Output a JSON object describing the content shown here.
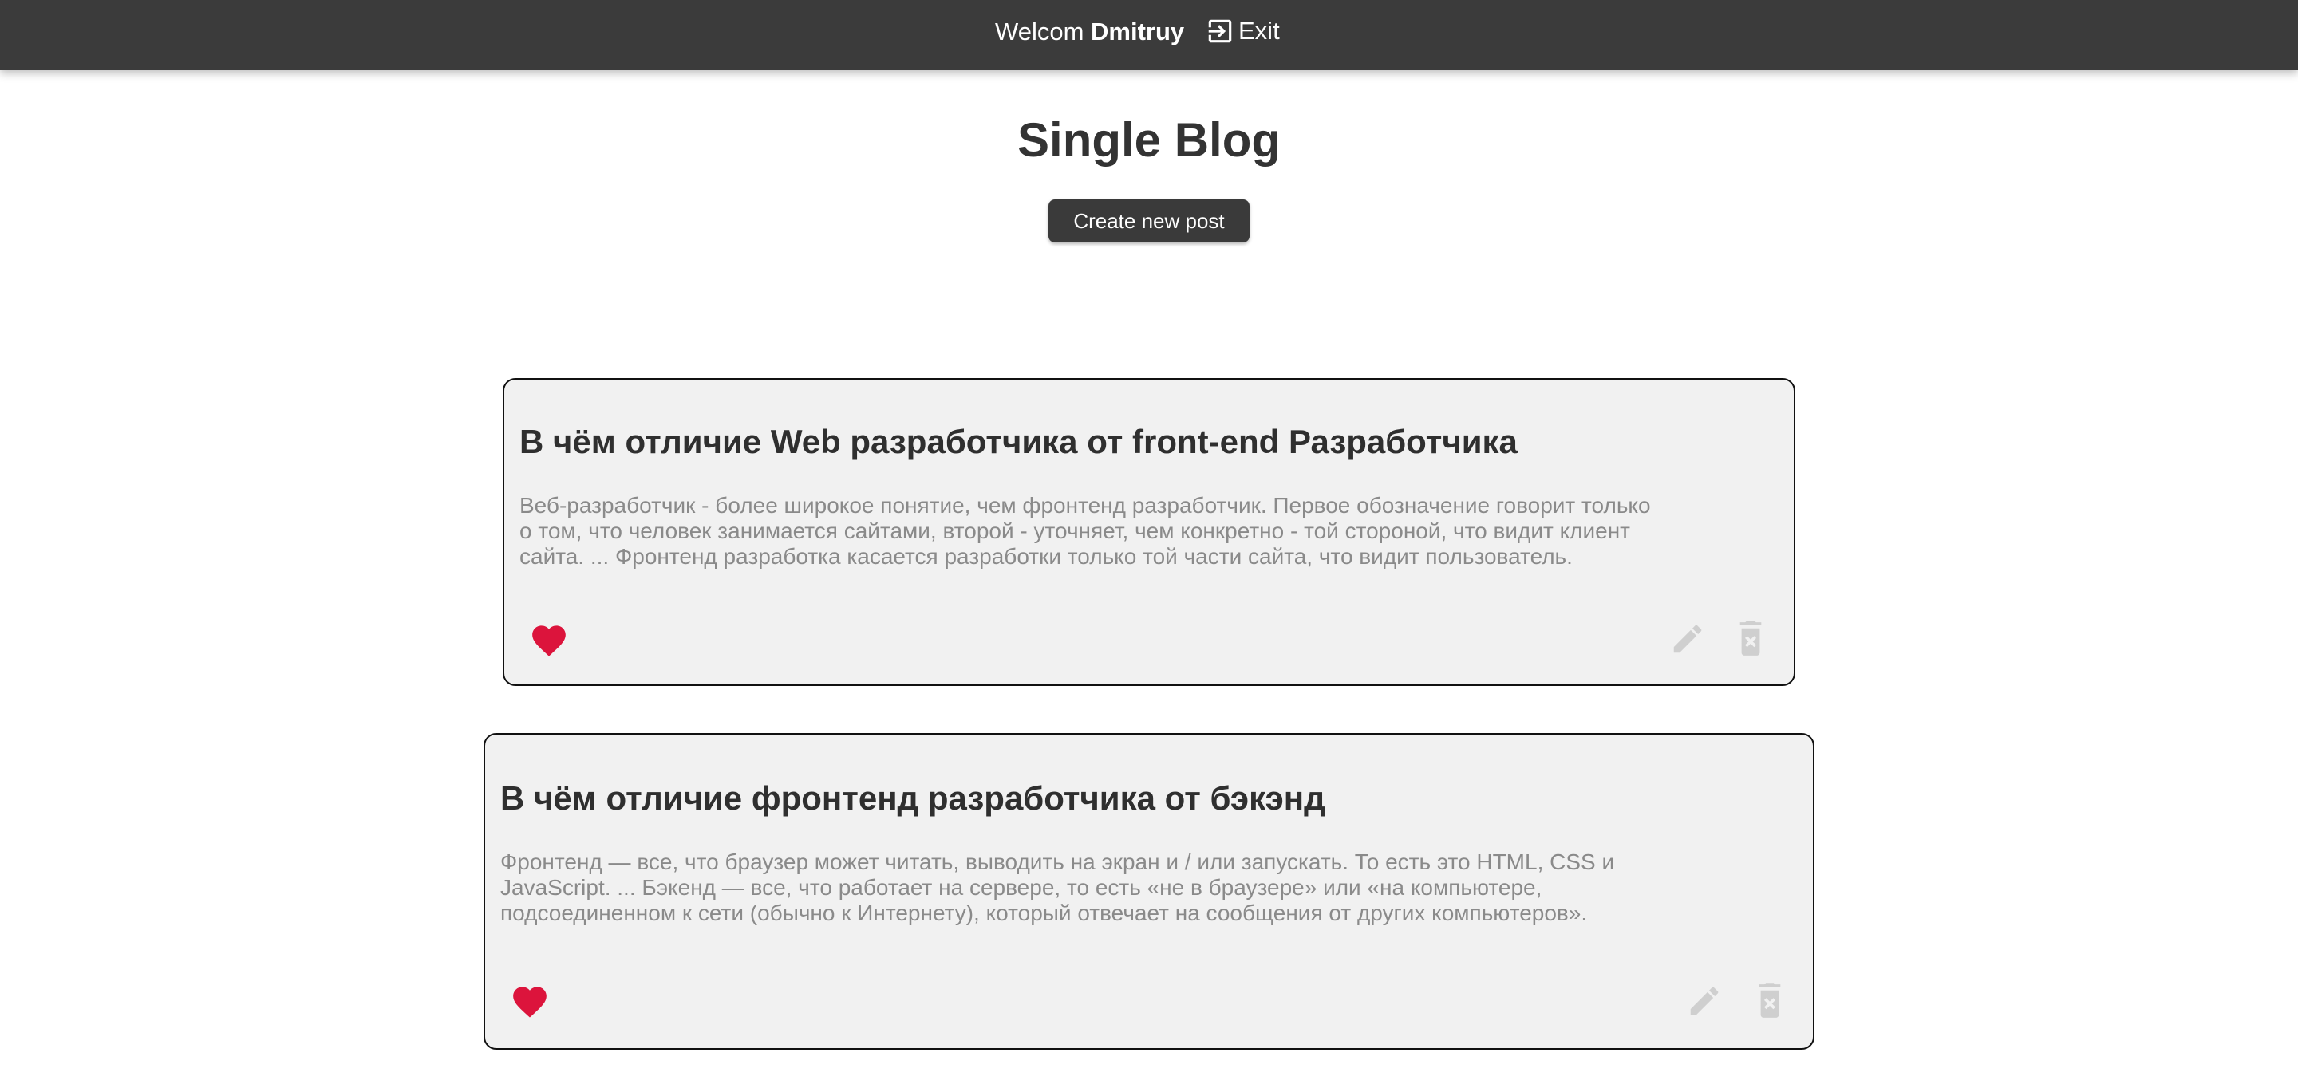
{
  "header": {
    "welcome_text": "Welcom",
    "username": "Dmitruy",
    "exit_label": "Exit",
    "exit_icon": "exit-icon"
  },
  "page": {
    "title": "Single Blog",
    "create_button_label": "Create new post"
  },
  "posts": [
    {
      "title": "В чём отличие Web разработчика от front-end Разработчика",
      "body": "Веб-разработчик - более широкое понятие, чем фронтенд разработчик. Первое обозначение говорит только о том, что человек занимается сайтами, второй - уточняет, чем конкретно - той стороной, что видит клиент сайта. ... Фронтенд разработка касается разработки только той части сайта, что видит пользователь.",
      "liked": true,
      "icons": [
        "heart-icon",
        "pencil-icon",
        "trash-icon"
      ]
    },
    {
      "title": "В чём отличие фронтенд разработчика от бэкэнд",
      "body": "Фронтенд — все, что браузер может читать, выводить на экран и / или запускать. То есть это HTML, CSS и JavaScript. ... Бэкенд — все, что работает на сервере, то есть «не в браузере» или «на компьютере, подсоединенном к сети (обычно к Интернету), который отвечает на сообщения от других компьютеров».",
      "liked": true,
      "icons": [
        "heart-icon",
        "pencil-icon",
        "trash-icon"
      ]
    }
  ],
  "colors": {
    "header_bg": "#3b3b3b",
    "card_bg": "#f1f1f1",
    "like_active": "#dc143c",
    "action_icon": "#cfcfcf",
    "body_text": "#8a8a8a"
  }
}
